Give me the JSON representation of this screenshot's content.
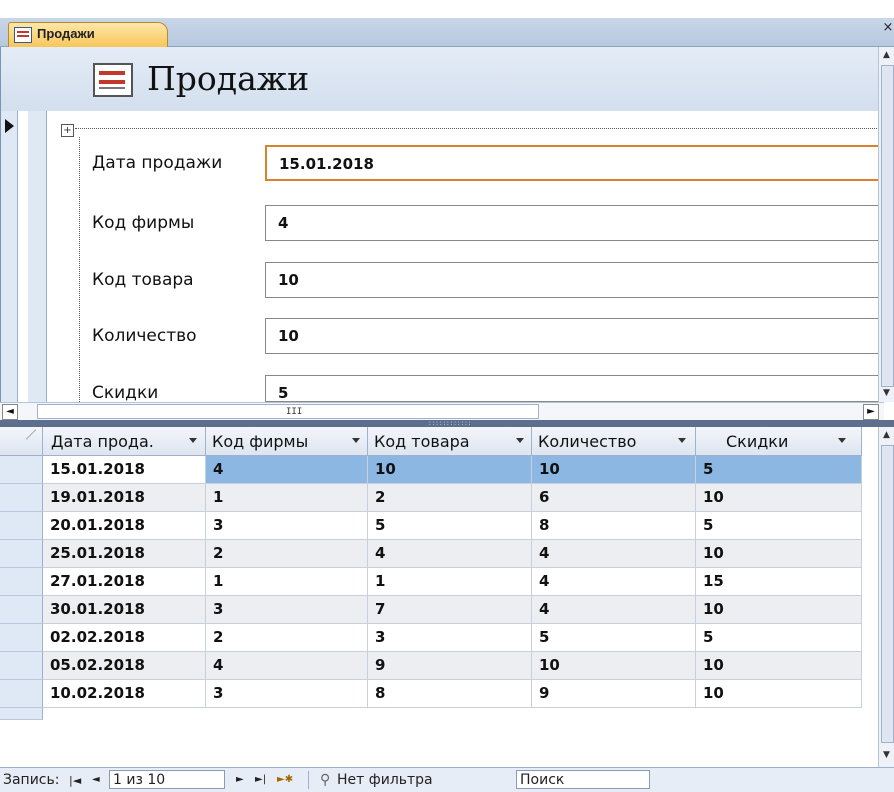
{
  "tab": {
    "label": "Продажи",
    "close": "×"
  },
  "form": {
    "title": "Продажи",
    "fields": [
      {
        "label": "Дата продажи",
        "value": "15.01.2018"
      },
      {
        "label": "Код фирмы",
        "value": "4"
      },
      {
        "label": "Код товара",
        "value": "10"
      },
      {
        "label": "Количество",
        "value": "10"
      },
      {
        "label": "Скидки",
        "value": "5"
      }
    ]
  },
  "grid": {
    "columns": [
      "Дата прода.",
      "Код фирмы",
      "Код товара",
      "Количество",
      "Скидки"
    ],
    "rows": [
      [
        "15.01.2018",
        "4",
        "10",
        "10",
        "5"
      ],
      [
        "19.01.2018",
        "1",
        "2",
        "6",
        "10"
      ],
      [
        "20.01.2018",
        "3",
        "5",
        "8",
        "5"
      ],
      [
        "25.01.2018",
        "2",
        "4",
        "4",
        "10"
      ],
      [
        "27.01.2018",
        "1",
        "1",
        "4",
        "15"
      ],
      [
        "30.01.2018",
        "3",
        "7",
        "4",
        "10"
      ],
      [
        "02.02.2018",
        "2",
        "3",
        "5",
        "5"
      ],
      [
        "05.02.2018",
        "4",
        "9",
        "10",
        "10"
      ],
      [
        "10.02.2018",
        "3",
        "8",
        "9",
        "10"
      ]
    ],
    "selected_row": 0
  },
  "navbar": {
    "record_label": "Запись:",
    "first": "|◄",
    "prev": "◄",
    "position": "1 из 10",
    "next": "►",
    "last": "►|",
    "new": "►✱",
    "filter_icon": "filter-icon",
    "filter_label": "Нет фильтра",
    "search_placeholder": "Поиск"
  },
  "scroll": {
    "h_grip": "III"
  },
  "colors": {
    "accent_border": "#d9822b",
    "selected_cell": "#8db7e3",
    "tab_bg": "#f8c65b"
  }
}
